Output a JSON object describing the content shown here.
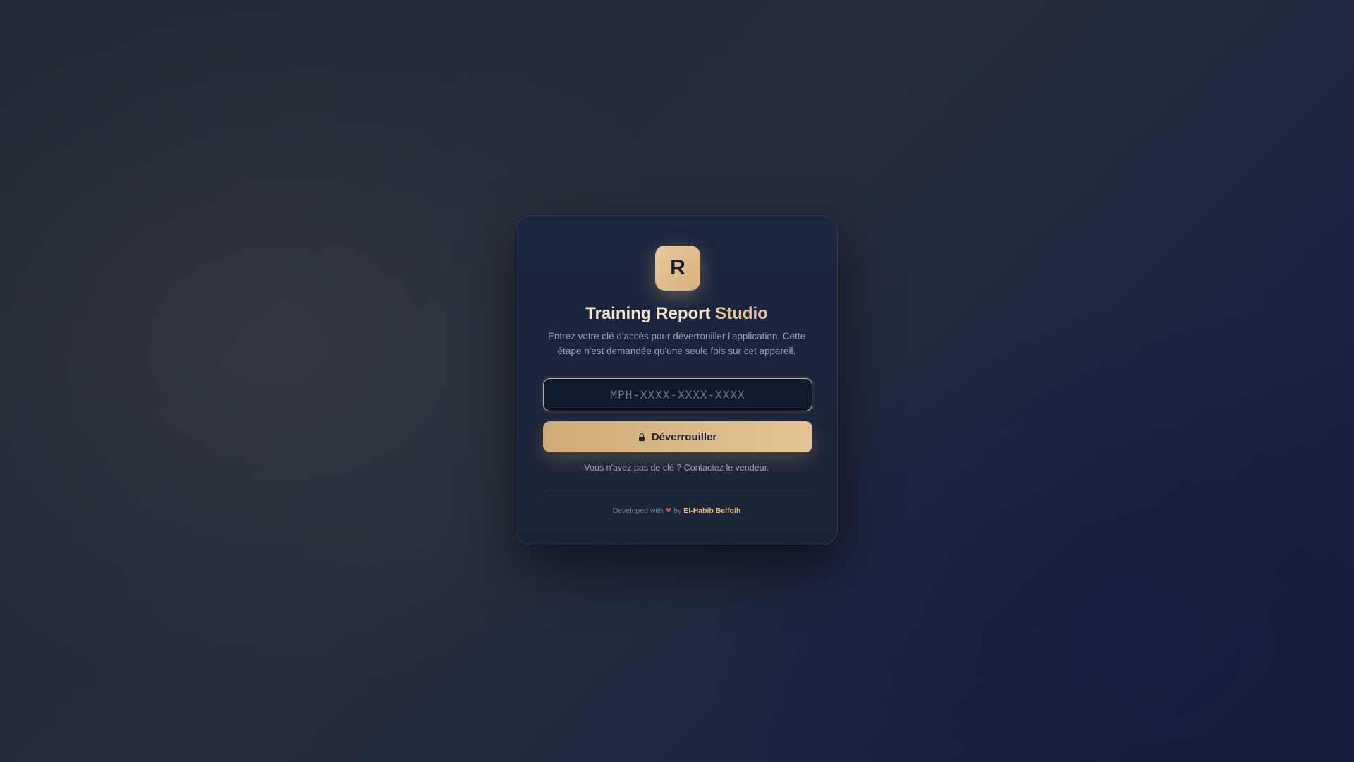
{
  "app": {
    "logo_letter": "R",
    "title_main": "Training Report",
    "title_accent": "Studio",
    "description": "Entrez votre clé d'accès pour déverrouiller l'application. Cette étape n'est demandée qu'une seule fois sur cet appareil."
  },
  "form": {
    "key_placeholder": "MPH-XXXX-XXXX-XXXX",
    "key_value": "",
    "unlock_label": "Déverrouiller",
    "unlock_icon": "lock-icon"
  },
  "help": {
    "text": "Vous n'avez pas de clé ? Contactez le vendeur."
  },
  "footer": {
    "prefix": "Developed with",
    "heart": "❤",
    "by": "by",
    "author": "El-Habib Belfqih"
  },
  "colors": {
    "accent": "#e0b986",
    "button_gradient_start": "#cfaa78",
    "button_gradient_end": "#e4c495",
    "card_background": "#1b2640",
    "heart": "#e0454f"
  }
}
